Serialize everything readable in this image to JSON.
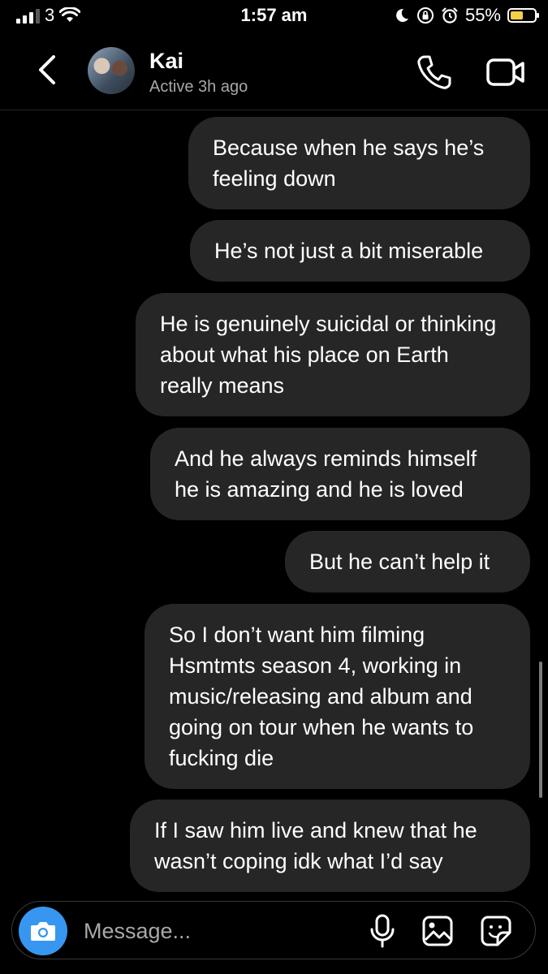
{
  "status_bar": {
    "carrier": "3",
    "time": "1:57 am",
    "battery": "55%",
    "battery_level": 0.55
  },
  "header": {
    "name": "Kai",
    "status": "Active 3h ago"
  },
  "messages": [
    {
      "text": "Because when he says he’s feeling down"
    },
    {
      "text": "He’s not just a bit miserable"
    },
    {
      "text": "He is genuinely suicidal or thinking about what his place on Earth really means"
    },
    {
      "text": "And he always reminds himself he is amazing and he is loved"
    },
    {
      "text": "But he can’t help it"
    },
    {
      "text": "So I don’t want him filming Hsmtmts season 4, working in music/releasing and album and going on tour when he wants to fucking die"
    },
    {
      "text": "If I saw him live and knew that he wasn’t coping idk what I’d say"
    }
  ],
  "composer": {
    "placeholder": "Message..."
  },
  "icons": {
    "back": "chevron-left-icon",
    "call": "phone-icon",
    "video": "video-camera-icon",
    "camera": "camera-icon",
    "mic": "microphone-icon",
    "image": "image-icon",
    "sticker": "sticker-icon"
  },
  "colors": {
    "background": "#000000",
    "bubble": "#262626",
    "secondary_text": "#a8a8a8",
    "camera_button": "#3797f0",
    "battery_fill": "#f7d048"
  }
}
